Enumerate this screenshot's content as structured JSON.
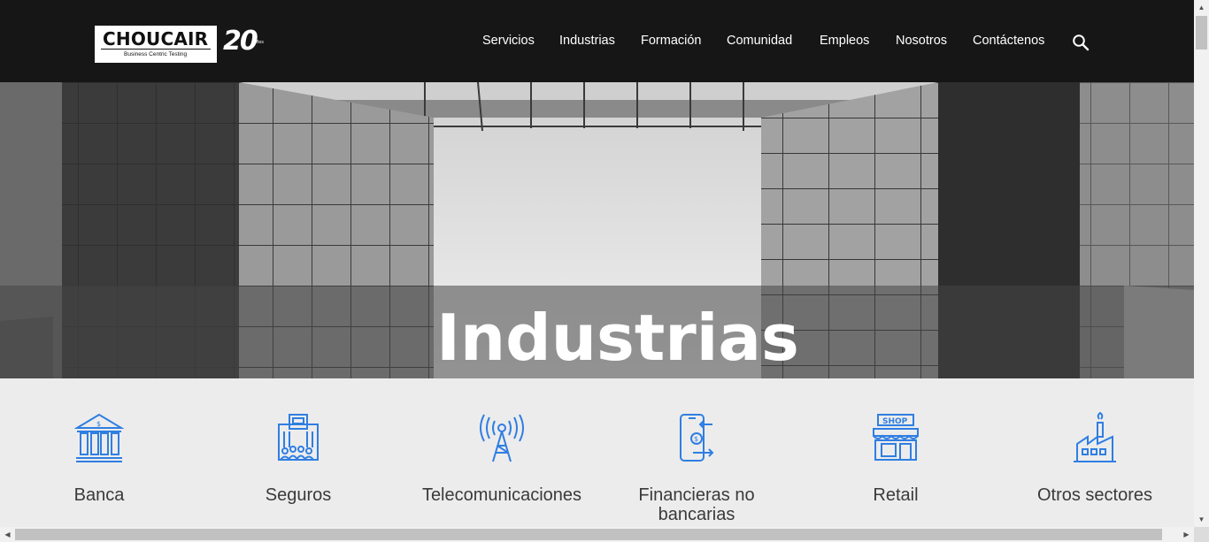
{
  "header": {
    "logo": {
      "word": "CHOUCAIR",
      "tagline": "Business Centric Testing",
      "anniversary": "20",
      "anniversary_small": "años"
    },
    "nav": [
      {
        "label": "Servicios"
      },
      {
        "label": "Industrias"
      },
      {
        "label": "Formación"
      },
      {
        "label": "Comunidad"
      },
      {
        "label": "Empleos"
      },
      {
        "label": "Nosotros"
      },
      {
        "label": "Contáctenos"
      }
    ],
    "search_icon": "search-icon"
  },
  "hero": {
    "title": "Industrias"
  },
  "industries": [
    {
      "label": "Banca",
      "icon": "bank-icon"
    },
    {
      "label": "Seguros",
      "icon": "insurance-building-icon"
    },
    {
      "label": "Telecomunicaciones",
      "icon": "antenna-tower-icon"
    },
    {
      "label": "Financieras no bancarias",
      "icon": "mobile-payment-icon"
    },
    {
      "label": "Retail",
      "icon": "shop-icon"
    },
    {
      "label": "Otros sectores",
      "icon": "factory-icon"
    }
  ],
  "colors": {
    "header_bg": "#161616",
    "icon_blue": "#2f7ee2",
    "body_bg": "#ececec"
  }
}
